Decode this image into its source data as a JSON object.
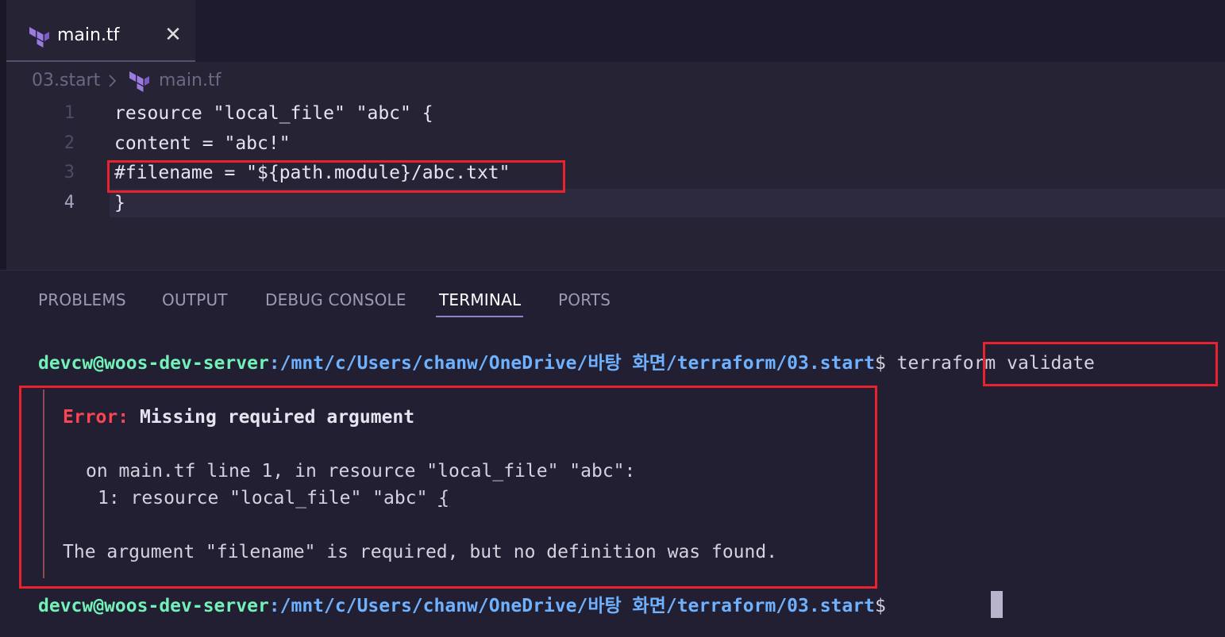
{
  "tab": {
    "label": "main.tf",
    "close": "✕",
    "icon": "terraform-icon"
  },
  "breadcrumb": {
    "folder": "03.start",
    "file": "main.tf"
  },
  "editor": {
    "lines": [
      {
        "num": "1",
        "text": "resource \"local_file\" \"abc\" {"
      },
      {
        "num": "2",
        "text": "content = \"abc!\""
      },
      {
        "num": "3",
        "text": "#filename = \"${path.module}/abc.txt\""
      },
      {
        "num": "4",
        "text": "}"
      }
    ]
  },
  "panel": {
    "tabs": [
      "PROBLEMS",
      "OUTPUT",
      "DEBUG CONSOLE",
      "TERMINAL",
      "PORTS"
    ],
    "active_tab": "TERMINAL"
  },
  "terminal": {
    "user": "devcw@woos-dev-server",
    "path": ":/mnt/c/Users/chanw/OneDrive/바탕 화면/terraform/03.start",
    "dollar": "$ ",
    "command": "terraform validate",
    "error": {
      "label": "Error:",
      "title": " Missing required argument",
      "location": "on main.tf line 1, in resource \"local_file\" \"abc\":",
      "snippet_prefix": "1: resource \"local_file\" \"abc\" ",
      "snippet_brace": "{",
      "message": "The argument \"filename\" is required, but no definition was found."
    }
  },
  "colors": {
    "background": "#262335",
    "highlight_box": "#e8232f",
    "prompt_user": "#72f1b8",
    "prompt_path": "#6eb1ff",
    "error": "#fe4450"
  }
}
